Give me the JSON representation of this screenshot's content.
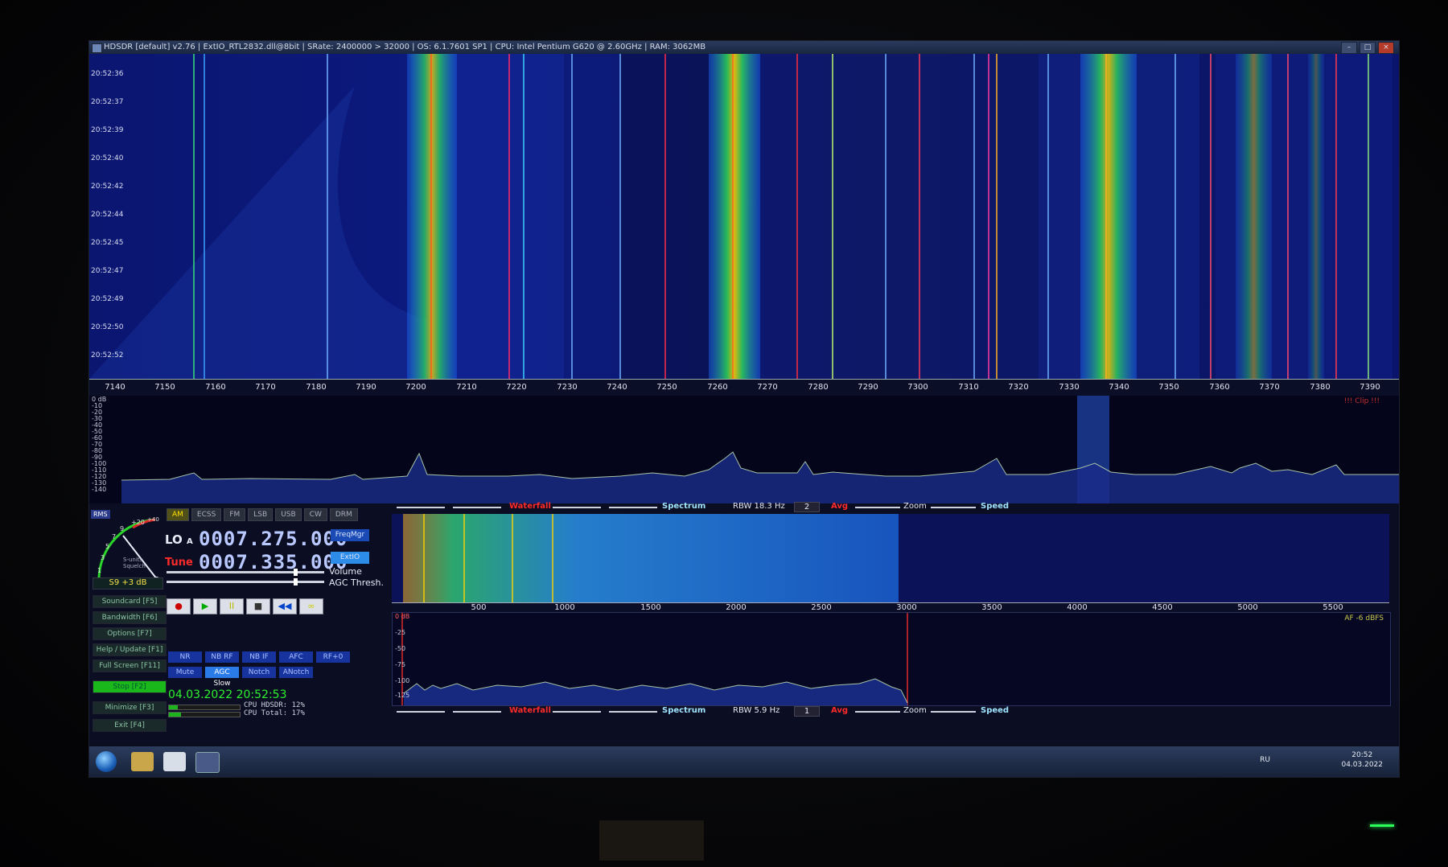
{
  "window": {
    "title": "HDSDR [default] v2.76 | ExtIO_RTL2832.dll@8bit | SRate: 2400000 > 32000 | OS: 6.1.7601 SP1 | CPU: Intel Pentium G620 @ 2.60GHz | RAM: 3062MB",
    "buttons": [
      "–",
      "□",
      "×"
    ]
  },
  "waterfall_main": {
    "timestamps": [
      "20:52:36",
      "20:52:37",
      "20:52:39",
      "20:52:40",
      "20:52:42",
      "20:52:44",
      "20:52:45",
      "20:52:47",
      "20:52:49",
      "20:52:50",
      "20:52:52"
    ],
    "freq_labels": [
      "7140",
      "7150",
      "7160",
      "7170",
      "7180",
      "7190",
      "7200",
      "7210",
      "7220",
      "7230",
      "7240",
      "7250",
      "7260",
      "7270",
      "7280",
      "7290",
      "7300",
      "7310",
      "7320",
      "7330",
      "7340",
      "7350",
      "7360",
      "7370",
      "7380",
      "7390"
    ]
  },
  "spectrum_main": {
    "db_labels": [
      "0 dB",
      "-10",
      "-20",
      "-30",
      "-40",
      "-50",
      "-60",
      "-70",
      "-80",
      "-90",
      "-100",
      "-110",
      "-120",
      "-130",
      "-140"
    ],
    "clip_label": "!!! Clip !!!"
  },
  "smeter": {
    "rms_label": "RMS",
    "scale": [
      "1",
      "3",
      "5",
      "7",
      "9",
      "+20",
      "+40"
    ],
    "labels": [
      "S-units",
      "Squelch"
    ],
    "reading": "S9 +3 dB"
  },
  "modes": [
    {
      "label": "AM",
      "active": true
    },
    {
      "label": "ECSS",
      "active": false
    },
    {
      "label": "FM",
      "active": false
    },
    {
      "label": "LSB",
      "active": false
    },
    {
      "label": "USB",
      "active": false
    },
    {
      "label": "CW",
      "active": false
    },
    {
      "label": "DRM",
      "active": false
    }
  ],
  "frequency": {
    "lo_label": "LO",
    "lo_sub": "A",
    "lo_value": "0007.275.000",
    "tune_label": "Tune",
    "tune_value": "0007.335.000",
    "freqmgr": "FreqMgr",
    "extio": "ExtIO"
  },
  "sliders": {
    "volume_label": "Volume",
    "agc_label": "AGC Thresh."
  },
  "side_buttons": [
    {
      "label": "Soundcard",
      "key": "[F5]"
    },
    {
      "label": "Bandwidth",
      "key": "[F6]"
    },
    {
      "label": "Options",
      "key": "[F7]"
    },
    {
      "label": "Help / Update",
      "key": "[F1]"
    },
    {
      "label": "Full Screen",
      "key": "[F11]"
    },
    {
      "label": "Stop",
      "key": "[F2]"
    },
    {
      "label": "Minimize",
      "key": "[F3]"
    },
    {
      "label": "Exit",
      "key": "[F4]"
    }
  ],
  "transport": [
    "●",
    "▶",
    "II",
    "■",
    "◀◀",
    "∞"
  ],
  "dsp_row1": [
    "NR",
    "NB RF",
    "NB IF",
    "AFC",
    "RF+0"
  ],
  "dsp_row2": [
    "Mute",
    "AGC Slow",
    "Notch",
    "ANotch"
  ],
  "status": {
    "datetime": "04.03.2022 20:52:53",
    "cpu_hdsdr": "CPU HDSDR: 12%",
    "cpu_total": "CPU Total: 17%"
  },
  "toolbar_top": {
    "waterfall": "Waterfall",
    "spectrum": "Spectrum",
    "rbw": "RBW 18.3 Hz",
    "avg_value": "2",
    "avg": "Avg",
    "zoom": "Zoom",
    "speed": "Speed"
  },
  "toolbar_bottom": {
    "waterfall": "Waterfall",
    "spectrum": "Spectrum",
    "rbw": "RBW 5.9 Hz",
    "avg_value": "1",
    "avg": "Avg",
    "zoom": "Zoom",
    "speed": "Speed"
  },
  "af_axis": [
    "500",
    "1000",
    "1500",
    "2000",
    "2500",
    "3000",
    "3500",
    "4000",
    "4500",
    "5000",
    "5500"
  ],
  "af_spectrum": {
    "db_labels": [
      "0 dB",
      "-25",
      "-50",
      "-75",
      "-100",
      "-125"
    ],
    "af_level": "AF -6 dBFS"
  },
  "taskbar": {
    "lang": "RU",
    "time": "20:52",
    "date": "04.03.2022"
  },
  "colors": {
    "accent_blue": "#1a4ab5",
    "ok_green": "#1ab81a",
    "tune_red": "#ff2a2a",
    "freq_digits": "#b9c8ff"
  }
}
